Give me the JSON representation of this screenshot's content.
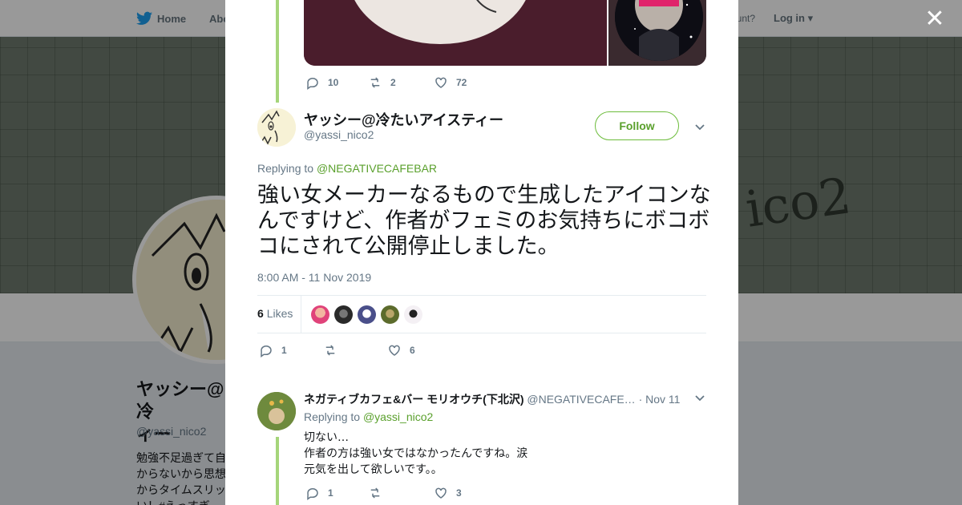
{
  "nav": {
    "home": "Home",
    "about": "Abo",
    "account": "ccount?",
    "login": "Log in"
  },
  "profile": {
    "name": "ヤッシー@冷\nィー",
    "handle": "@yassi_nico2",
    "bio": "勉強不足過ぎて自\nからないから思想\nからタイムスリッ\nい！#えっすぎ",
    "banner_text": "ico2"
  },
  "previous_tweet": {
    "replies": "10",
    "retweets": "2",
    "likes": "72"
  },
  "main_tweet": {
    "name": "ヤッシー@冷たいアイスティー",
    "handle": "@yassi_nico2",
    "follow_label": "Follow",
    "replying_prefix": "Replying to",
    "replying_handle": "@NEGATIVECAFEBAR",
    "text": "強い女メーカーなるもので生成したアイコンなんですけど、作者がフェミのお気持ちにボコボコにされて公開停止しました。",
    "timestamp": "8:00 AM - 11 Nov 2019",
    "likes_count": "6",
    "likes_label": "Likes",
    "replies": "1",
    "retweets": "",
    "likes": "6"
  },
  "reply_tweet": {
    "name": "ネガティブカフェ&バー モリオウチ(下北沢)",
    "handle": "@NEGATIVECAFE…",
    "date": "· Nov 11",
    "replying_prefix": "Replying to",
    "replying_handle": "@yassi_nico2",
    "text": "切ない…\n作者の方は強い女ではなかったんですね。涙\n元気を出して欲しいです。。",
    "replies": "1",
    "retweets": "",
    "likes": "3"
  },
  "colors": {
    "accent": "#5aa02c",
    "thread": "#a5d57a",
    "muted": "#657786"
  }
}
